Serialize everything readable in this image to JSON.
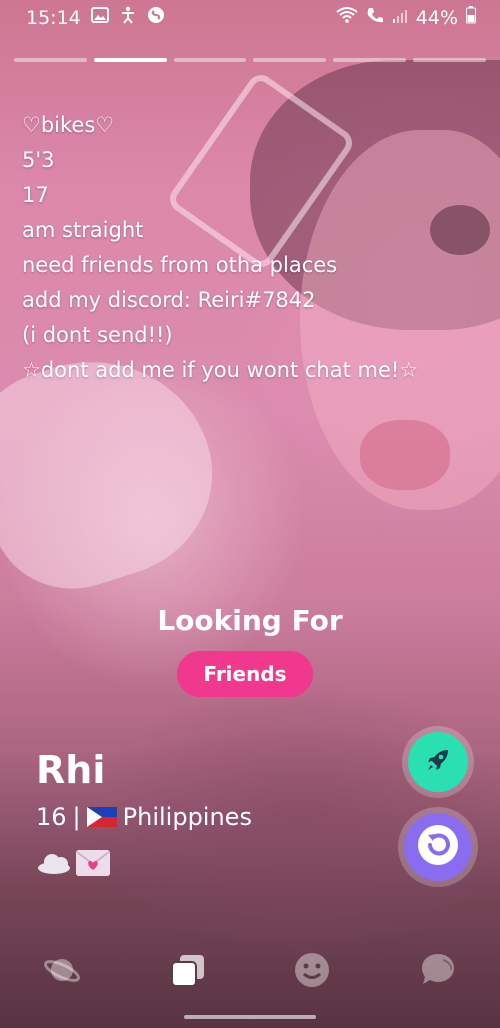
{
  "status_bar": {
    "time": "15:14",
    "battery": "44%",
    "left_icons": [
      "image-icon",
      "accessibility-icon",
      "shazam-icon"
    ],
    "right_icons": [
      "wifi-icon",
      "wifi-calling-icon",
      "signal-icon",
      "battery-icon"
    ]
  },
  "stories": {
    "count": 6,
    "active_index": 1
  },
  "bio": {
    "lines": [
      "♡bikes♡",
      "5'3",
      "17",
      "am straight",
      "need friends from otha places",
      "add my discord: Reiri#7842",
      "(i dont send!!)",
      "☆dont add me if you wont chat me!☆"
    ]
  },
  "looking_for": {
    "title": "Looking For",
    "value": "Friends"
  },
  "profile": {
    "name": "Rhi",
    "age": "16",
    "separator": "|",
    "country": "Philippines",
    "badges": [
      "cloud-icon",
      "love-letter-icon"
    ]
  },
  "actions": [
    "boost-rocket-button",
    "rewind-button"
  ],
  "bottom_nav": {
    "items": [
      "discover-planet-icon",
      "cards-icon",
      "smiley-icon",
      "chat-bubble-icon"
    ],
    "active": "cards-icon"
  },
  "colors": {
    "accent_pink": "#f0388f",
    "boost_green": "#2be0b0",
    "rewind_purple": "#8a6cf0"
  }
}
